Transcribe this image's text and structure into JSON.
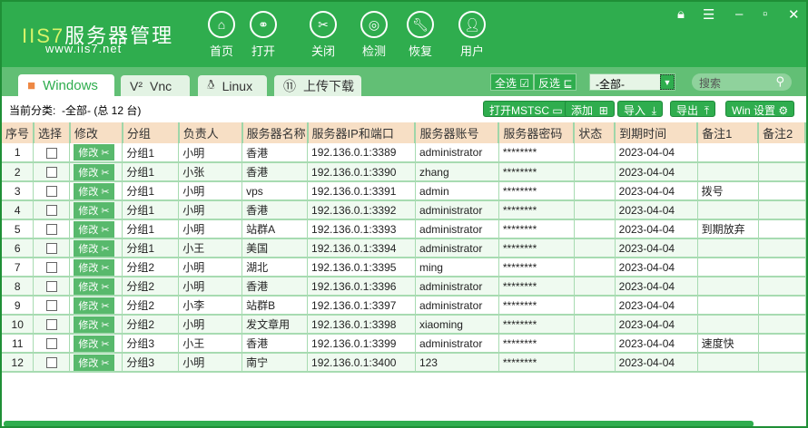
{
  "app": {
    "logo_prefix": "IIS7",
    "logo_rest": "服务器管理",
    "url": "www.iis7.net"
  },
  "nav": [
    {
      "label": "首页",
      "icon": "home-icon"
    },
    {
      "label": "打开",
      "icon": "link-icon"
    },
    {
      "label": "关闭",
      "icon": "unlink-icon"
    },
    {
      "label": "检测",
      "icon": "radar-icon"
    },
    {
      "label": "恢复",
      "icon": "wrench-icon"
    },
    {
      "label": "用户",
      "icon": "user-icon"
    }
  ],
  "tabs": [
    {
      "label": "Windows",
      "icon": "windows-icon"
    },
    {
      "label": "Vnc",
      "icon": "vnc-icon"
    },
    {
      "label": "Linux",
      "icon": "linux-icon"
    },
    {
      "label": "上传下载",
      "icon": "transfer-icon"
    }
  ],
  "toolbar": {
    "select_all": "全选",
    "invert": "反选",
    "group_select": "-全部-",
    "search_placeholder": "搜索"
  },
  "current": {
    "label": "当前分类:",
    "value": "-全部- (总 12 台)"
  },
  "actions": {
    "mstsc": "打开MSTSC",
    "add": "添加",
    "import": "导入",
    "export": "导出",
    "win_settings": "Win 设置"
  },
  "colors": {
    "primary": "#2fad4e",
    "header": "#f7dfc5"
  },
  "table": {
    "columns": [
      "序号",
      "选择",
      "修改",
      "分组",
      "负责人",
      "服务器名称",
      "服务器IP和端口",
      "服务器账号",
      "服务器密码",
      "状态",
      "到期时间",
      "备注1",
      "备注2"
    ],
    "edit_label": "修改",
    "rows": [
      [
        "1",
        "分组1",
        "小明",
        "香港",
        "192.136.0.1:3389",
        "administrator",
        "********",
        "",
        "2023-04-04",
        "",
        ""
      ],
      [
        "2",
        "分组1",
        "小张",
        "香港",
        "192.136.0.1:3390",
        "zhang",
        "********",
        "",
        "2023-04-04",
        "",
        ""
      ],
      [
        "3",
        "分组1",
        "小明",
        "vps",
        "192.136.0.1:3391",
        "admin",
        "********",
        "",
        "2023-04-04",
        "拨号",
        ""
      ],
      [
        "4",
        "分组1",
        "小明",
        "香港",
        "192.136.0.1:3392",
        "administrator",
        "********",
        "",
        "2023-04-04",
        "",
        ""
      ],
      [
        "5",
        "分组1",
        "小明",
        "站群A",
        "192.136.0.1:3393",
        "administrator",
        "********",
        "",
        "2023-04-04",
        "到期放弃",
        ""
      ],
      [
        "6",
        "分组1",
        "小王",
        "美国",
        "192.136.0.1:3394",
        "administrator",
        "********",
        "",
        "2023-04-04",
        "",
        ""
      ],
      [
        "7",
        "分组2",
        "小明",
        "湖北",
        "192.136.0.1:3395",
        "ming",
        "********",
        "",
        "2023-04-04",
        "",
        ""
      ],
      [
        "8",
        "分组2",
        "小明",
        "香港",
        "192.136.0.1:3396",
        "administrator",
        "********",
        "",
        "2023-04-04",
        "",
        ""
      ],
      [
        "9",
        "分组2",
        "小李",
        "站群B",
        "192.136.0.1:3397",
        "administrator",
        "********",
        "",
        "2023-04-04",
        "",
        ""
      ],
      [
        "10",
        "分组2",
        "小明",
        "发文章用",
        "192.136.0.1:3398",
        "xiaoming",
        "********",
        "",
        "2023-04-04",
        "",
        ""
      ],
      [
        "11",
        "分组3",
        "小王",
        "香港",
        "192.136.0.1:3399",
        "administrator",
        "********",
        "",
        "2023-04-04",
        "速度快",
        ""
      ],
      [
        "12",
        "分组3",
        "小明",
        "南宁",
        "192.136.0.1:3400",
        "123",
        "********",
        "",
        "2023-04-04",
        "",
        ""
      ]
    ]
  }
}
